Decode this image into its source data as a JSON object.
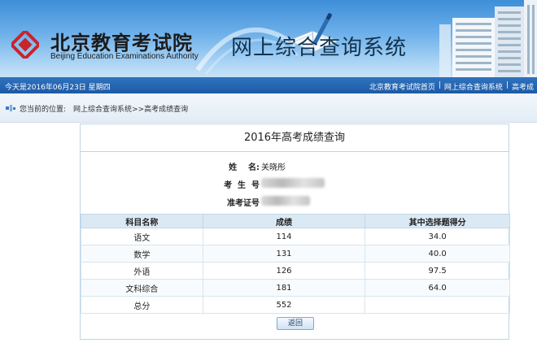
{
  "header": {
    "logo_cn": "北京教育考试院",
    "logo_en": "Beijing Education Examinations Authority",
    "system_title": "网上综合查询系统"
  },
  "topbar": {
    "date_text": "今天是2016年06月23日 星期四",
    "links": [
      "北京教育考试院首页",
      "网上综合查询系统",
      "高考成"
    ]
  },
  "breadcrumb": {
    "prefix": "您当前的位置:",
    "items": [
      "网上综合查询系统",
      ">>高考成绩查询"
    ]
  },
  "panel": {
    "title": "2016年高考成绩查询",
    "info": [
      {
        "label": "姓    名:",
        "value": "关晓彤"
      },
      {
        "label": "考  生  号",
        "value": ""
      },
      {
        "label": "准考证号",
        "value": ""
      }
    ],
    "columns": [
      "科目名称",
      "成绩",
      "其中选择题得分"
    ],
    "rows": [
      {
        "subject": "语文",
        "score": "114",
        "choice": "34.0"
      },
      {
        "subject": "数学",
        "score": "131",
        "choice": "40.0"
      },
      {
        "subject": "外语",
        "score": "126",
        "choice": "97.5"
      },
      {
        "subject": "文科综合",
        "score": "181",
        "choice": "64.0"
      },
      {
        "subject": "总分",
        "score": "552",
        "choice": ""
      }
    ],
    "back_label": "返回"
  },
  "colors": {
    "topbar": "#1d5aa6",
    "table_header": "#dbe9f5",
    "panel_border": "#bcd6e6"
  }
}
